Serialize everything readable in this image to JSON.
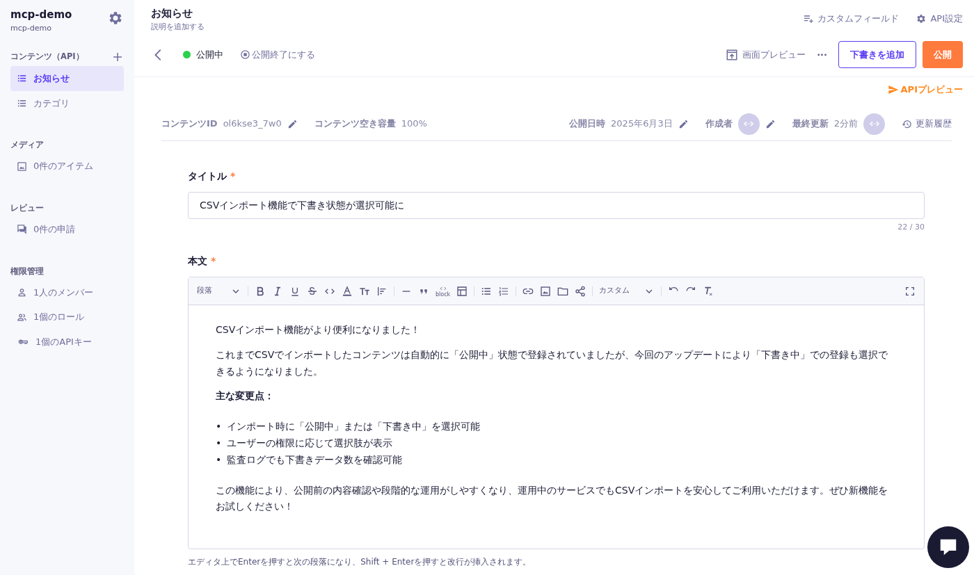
{
  "sidebar": {
    "service_name": "mcp-demo",
    "service_id": "mcp-demo",
    "sections": [
      {
        "heading": "コンテンツ（API）",
        "addable": true,
        "items": [
          {
            "label": "お知らせ",
            "selected": true
          },
          {
            "label": "カテゴリ",
            "selected": false
          }
        ]
      },
      {
        "heading": "メディア",
        "addable": false,
        "items": [
          {
            "label": "0件のアイテム",
            "selected": false
          }
        ]
      },
      {
        "heading": "レビュー",
        "addable": false,
        "items": [
          {
            "label": "0件の申請",
            "selected": false
          }
        ]
      },
      {
        "heading": "権限管理",
        "addable": false,
        "items": [
          {
            "label": "1人のメンバー",
            "selected": false
          },
          {
            "label": "1個のロール",
            "selected": false
          },
          {
            "label": "1個のAPIキー",
            "selected": false
          }
        ]
      }
    ]
  },
  "header": {
    "title": "お知らせ",
    "description": "説明を追加する",
    "links": [
      "カスタムフィールド",
      "API設定"
    ]
  },
  "actions": {
    "status": "公開中",
    "unpublish": "公開終了にする",
    "preview": "画面プレビュー",
    "more": "···",
    "draft_button": "下書きを追加",
    "publish_button": "公開",
    "api_preview": "APIプレビュー"
  },
  "meta": {
    "content_id_label": "コンテンツID",
    "content_id": "ol6kse3_7w0",
    "capacity_label": "コンテンツ空き容量",
    "capacity": "100%",
    "published_label": "公開日時",
    "published": "2025年6月3日",
    "author_label": "作成者",
    "updated_label": "最終更新",
    "updated": "2分前",
    "history": "更新履歴"
  },
  "title_field": {
    "label": "タイトル",
    "required_mark": "*",
    "value": "CSVインポート機能で下書き状態が選択可能に",
    "counter": "22 / 30"
  },
  "body_field": {
    "label": "本文",
    "required_mark": "*",
    "toolbar": {
      "block_format": "段落",
      "code_block_caption": "block",
      "custom": "カスタム"
    },
    "content": [
      {
        "kind": "paragraph",
        "text": "CSVインポート機能がより便利になりました！"
      },
      {
        "kind": "paragraph",
        "text": "これまでCSVでインポートしたコンテンツは自動的に「公開中」状態で登録されていましたが、今回のアップデートにより「下書き中」での登録も選択できるようになりました。"
      },
      {
        "kind": "heading",
        "text": "主な変更点："
      },
      {
        "kind": "list",
        "items": [
          {
            "marker": "•",
            "text": "インポート時に「公開中」または「下書き中」を選択可能"
          },
          {
            "marker": "•",
            "text": "ユーザーの権限に応じて選択肢が表示"
          },
          {
            "marker": "•",
            "text": "監査ログでも下書きデータ数を確認可能"
          }
        ]
      },
      {
        "kind": "paragraph",
        "text": "この機能により、公開前の内容確認や段階的な運用がしやすくなり、運用中のサービスでもCSVインポートを安心してご利用いただけます。ぜひ新機能をお試しください！"
      }
    ],
    "hint": "エディタ上でEnterを押すと次の段落になり、Shift + Enterを押すと改行が挿入されます。"
  }
}
